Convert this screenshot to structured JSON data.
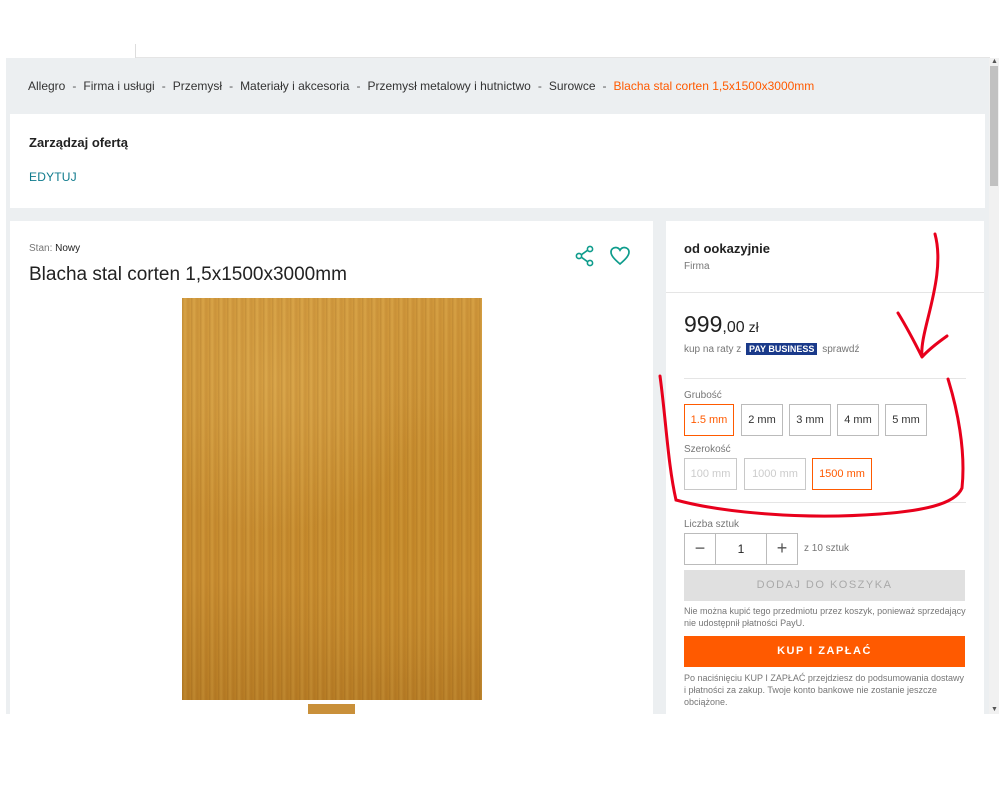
{
  "breadcrumb": {
    "items": [
      "Allegro",
      "Firma i usługi",
      "Przemysł",
      "Materiały i akcesoria",
      "Przemysł metalowy i hutnictwo",
      "Surowce"
    ],
    "current": "Blacha stal corten 1,5x1500x3000mm",
    "separator": "-"
  },
  "manage": {
    "title": "Zarządzaj ofertą",
    "edit_label": "EDYTUJ"
  },
  "product": {
    "condition_label": "Stan:",
    "condition_value": "Nowy",
    "title": "Blacha stal corten 1,5x1500x3000mm"
  },
  "seller": {
    "name": "od ookazyjnie",
    "type": "Firma"
  },
  "price": {
    "whole": "999",
    "cents": ",00",
    "currency": "zł",
    "installments_prefix": "kup na raty z",
    "installments_badge": "PAY BUSINESS",
    "installments_suffix": "sprawdź"
  },
  "thickness": {
    "label": "Grubość",
    "options": [
      "1.5 mm",
      "2 mm",
      "3 mm",
      "4 mm",
      "5 mm"
    ],
    "selected": "1.5 mm"
  },
  "width": {
    "label": "Szerokość",
    "options": [
      "100 mm",
      "1000 mm",
      "1500 mm"
    ],
    "selected": "1500 mm"
  },
  "quantity": {
    "label": "Liczba sztuk",
    "minus": "−",
    "value": "1",
    "plus": "+",
    "of_label": "z 10 sztuk"
  },
  "cart": {
    "button_label": "DODAJ DO KOSZYKA",
    "note": "Nie można kupić tego przedmiotu przez koszyk, ponieważ sprzedający nie udostępnił płatności PayU."
  },
  "buy": {
    "button_label": "KUP I ZAPŁAĆ",
    "note": "Po naciśnięciu KUP I ZAPŁAĆ przejdziesz do podsumowania dostawy i płatności za zakup. Twoje konto bankowe nie zostanie jeszcze obciążone."
  },
  "colors": {
    "accent": "#ff5a00",
    "link": "#0e7a8c",
    "annotation": "#e8001c"
  },
  "icons": [
    "share-icon",
    "heart-icon"
  ]
}
